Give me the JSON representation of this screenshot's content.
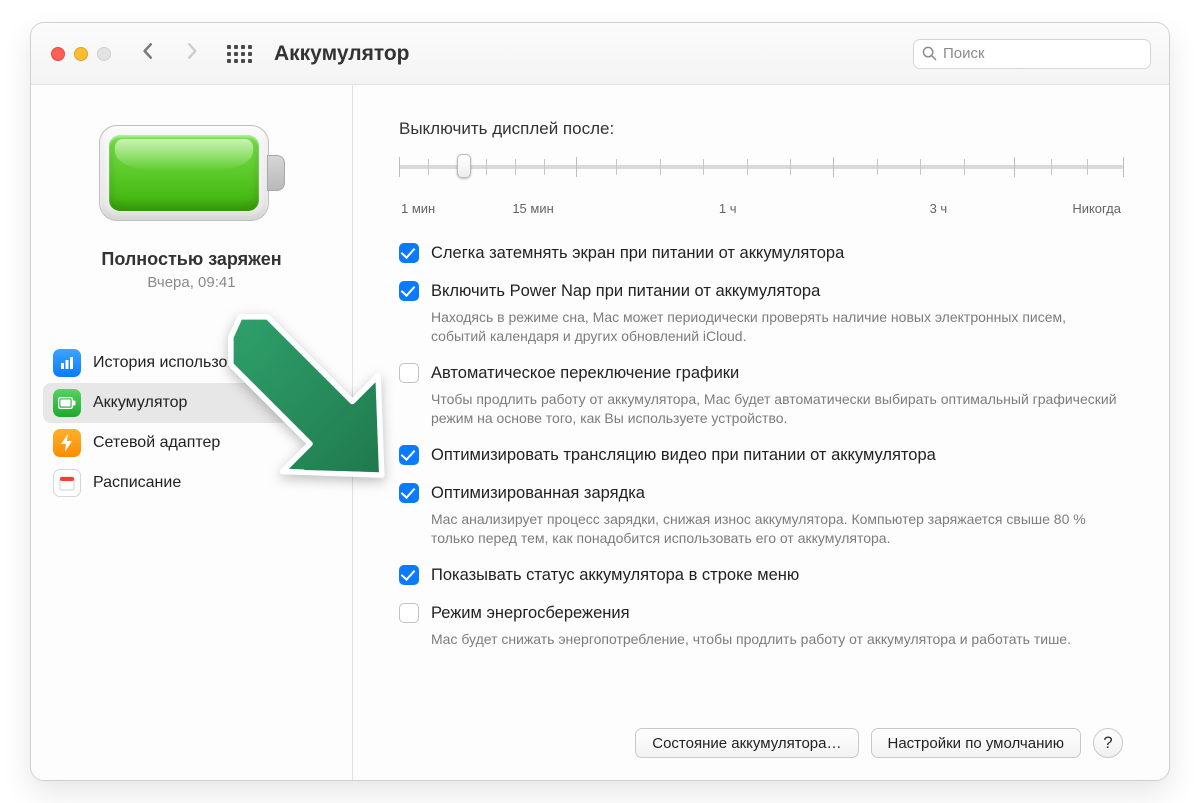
{
  "toolbar": {
    "title": "Аккумулятор",
    "search_placeholder": "Поиск"
  },
  "sidebar": {
    "status_title": "Полностью заряжен",
    "status_time": "Вчера, 09:41",
    "items": [
      {
        "label": "История использования"
      },
      {
        "label": "Аккумулятор"
      },
      {
        "label": "Сетевой адаптер"
      },
      {
        "label": "Расписание"
      }
    ]
  },
  "main": {
    "slider_label": "Выключить дисплей после:",
    "slider_scale": [
      "1 мин",
      "15 мин",
      "1 ч",
      "3 ч",
      "Никогда"
    ],
    "options": [
      {
        "checked": true,
        "label": "Слегка затемнять экран при питании от аккумулятора",
        "desc": ""
      },
      {
        "checked": true,
        "label": "Включить Power Nap при питании от аккумулятора",
        "desc": "Находясь в режиме сна, Mac может периодически проверять наличие новых электронных писем, событий календаря и других обновлений iCloud."
      },
      {
        "checked": false,
        "label": "Автоматическое переключение графики",
        "desc": "Чтобы продлить работу от аккумулятора, Mac будет автоматически выбирать оптимальный графический режим на основе того, как Вы используете устройство."
      },
      {
        "checked": true,
        "label": "Оптимизировать трансляцию видео при питании от аккумулятора",
        "desc": ""
      },
      {
        "checked": true,
        "label": "Оптимизированная зарядка",
        "desc": "Mac анализирует процесс зарядки, снижая износ аккумулятора. Компьютер заряжается свыше 80 % только перед тем, как понадобится использовать его от аккумулятора."
      },
      {
        "checked": true,
        "label": "Показывать статус аккумулятора в строке меню",
        "desc": ""
      },
      {
        "checked": false,
        "label": "Режим энергосбережения",
        "desc": "Mac будет снижать энергопотребление, чтобы продлить работу от аккумулятора и работать тише."
      }
    ],
    "buttons": {
      "health": "Состояние аккумулятора…",
      "defaults": "Настройки по умолчанию",
      "help": "?"
    }
  }
}
